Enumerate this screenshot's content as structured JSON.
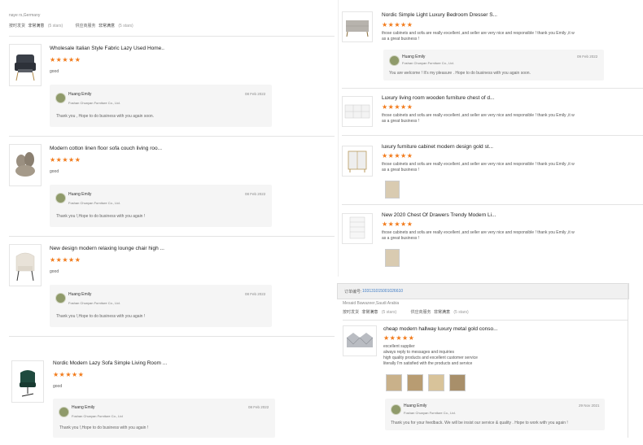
{
  "left_header": {
    "buyer": "naye rs,Germany",
    "rating1_label": "按时发货",
    "rating1_value": "非常满意",
    "rating1_stars": "(5 stars)",
    "rating2_label": "供应商服务",
    "rating2_value": "非常满意",
    "rating2_stars": "(5 stars)"
  },
  "left_reviews": [
    {
      "title": "Wholesale Italian Style Fabric Lazy Used Home..",
      "stars": "★★★★★",
      "comment": "good",
      "reply": {
        "name": "Huang Emily",
        "company": "Foshan Chunyan Furniture Co., Ltd.",
        "date": "08 Feb 2022",
        "text": "Thank you , Hope to do business with you again soon."
      }
    },
    {
      "title": "Modern cotton linen floor sofa couch living roo...",
      "stars": "★★★★★",
      "comment": "good",
      "reply": {
        "name": "Huang Emily",
        "company": "Foshan Chunyan Furniture Co., Ltd.",
        "date": "08 Feb 2022",
        "text": "Thank you !,Hope to do business with you again !"
      }
    },
    {
      "title": "New design modern relaxing lounge chair high ...",
      "stars": "★★★★★",
      "comment": "good",
      "reply": {
        "name": "Huang Emily",
        "company": "Foshan Chunyan Furniture Co., Ltd.",
        "date": "08 Feb 2022",
        "text": "Thank you !,Hope to do business with you again !"
      }
    },
    {
      "title": "Nordic Modern Lazy Sofa Simple Living Room ...",
      "stars": "★★★★★",
      "comment": "good",
      "reply": {
        "name": "Huang Emily",
        "company": "Foshan Chunyan Furniture Co., Ltd",
        "date": "08 Feb 2022",
        "text": "Thank you !,Hope to do business with you again !"
      }
    }
  ],
  "right_reviews": [
    {
      "title": "Nordic Simple Light Luxury Bedroom Dresser S...",
      "stars": "★★★★★",
      "comment_line1": "those cabinets and sofa are really excellent ,and seller are very nice and responsible ! thank you Emily ,it w",
      "comment_line2": "as a great business !",
      "reply": {
        "name": "Huang Emily",
        "company": "Foshan Chunyan Furniture Co., Ltd.",
        "date": "09 Feb 2022",
        "text": "You are welcome  !  It's my pleasure . Hope to do business with you again soon."
      }
    },
    {
      "title": "Luxury living room wooden furniture chest of d...",
      "stars": "★★★★★",
      "comment_line1": "those cabinets and sofa are really excellent ,and seller are very nice and responsible ! thank you Emily ,it w",
      "comment_line2": "as a great business !"
    },
    {
      "title": "luxury furniture cabinet modern design gold st...",
      "stars": "★★★★★",
      "comment_line1": "those cabinets and sofa are really excellent ,and seller are very nice and responsible ! thank you Emily ,it w",
      "comment_line2": "as a great business !"
    },
    {
      "title": "New 2020 Chest Of Drawers Trendy Modern Li...",
      "stars": "★★★★★",
      "comment_line1": "those cabinets and sofa are really excellent ,and seller are very nice and responsible ! thank you Emily ,it w",
      "comment_line2": "as a great business !"
    }
  ],
  "order": {
    "label": "订单编号:",
    "number": "103131015001026610",
    "buyer": "Mesaid Bawazeer,Saudi Arabia",
    "rating1_label": "按时发货",
    "rating1_value": "非常满意",
    "rating1_stars": "(5 stars)",
    "rating2_label": "供应商服务",
    "rating2_value": "非常满意",
    "rating2_stars": "(5 stars)",
    "review": {
      "title": "cheap modern hallway luxury metal gold conso...",
      "stars": "★★★★★",
      "lines": [
        "excellent supplier",
        "always reply to messages and inquiries",
        "high quality products and excellent customer service",
        "literally I'm satisfied with the products and service"
      ],
      "reply": {
        "name": "Huang Emily",
        "company": "Foshan Chunyan Furniture Co., Ltd.",
        "date": "29 Nov 2021",
        "text": "Thank you for your feedback. We will be insist our service & quality . Hope to work with you again !"
      }
    }
  },
  "colors": {
    "star": "#f27a1a",
    "link": "#3d7bc4",
    "reply_bg": "#f5f5f5"
  }
}
